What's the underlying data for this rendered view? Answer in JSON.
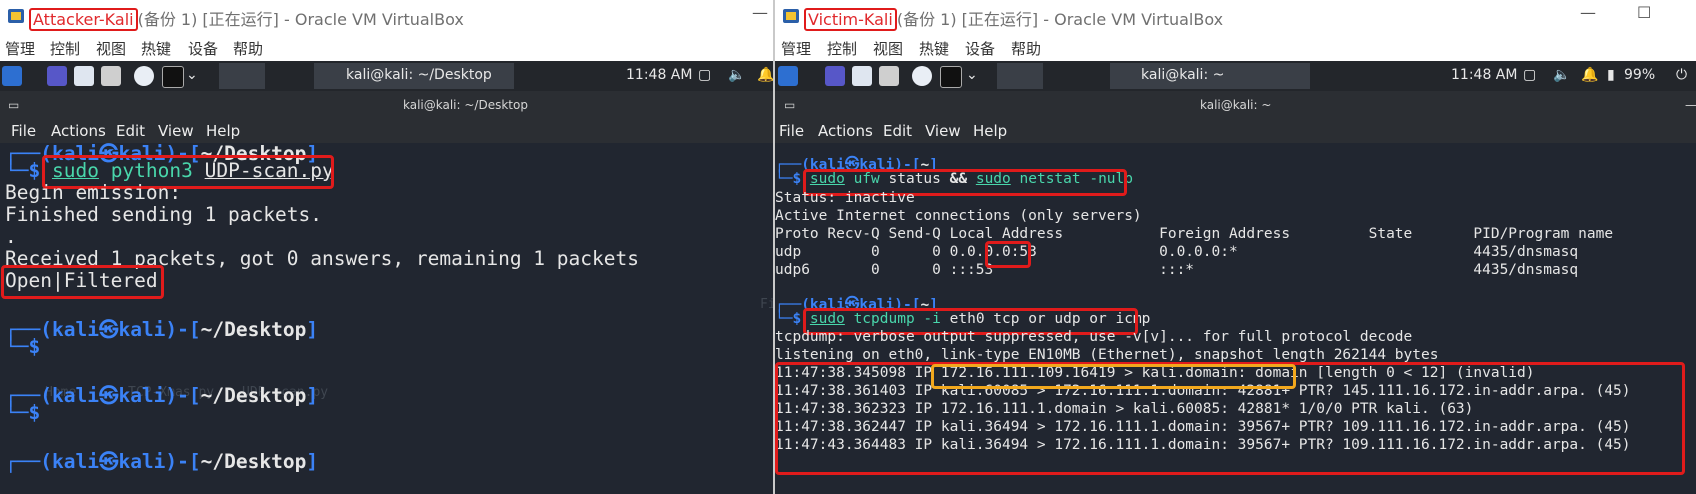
{
  "left": {
    "window_title_vm": "Attacker-Kali",
    "window_title_rest": "(备份 1) [正在运行] - Oracle VM VirtualBox",
    "menu": [
      "管理",
      "控制",
      "视图",
      "热键",
      "设备",
      "帮助"
    ],
    "panel": {
      "task_label": "kali@kali: ~/Desktop",
      "clock": "11:48 AM"
    },
    "term_title": "kali@kali: ~/Desktop",
    "term_menu": [
      "File",
      "Actions",
      "Edit",
      "View",
      "Help"
    ],
    "terminal": {
      "prompt_user": "kali",
      "prompt_at": "㉿",
      "prompt_host": "kali",
      "dir": "~/Desktop",
      "cmd_sudo": "sudo",
      "cmd_python": "python3",
      "cmd_script": "UDP-scan.py",
      "out1": "Begin emission:",
      "out2": "Finished sending 1 packets.",
      "out3": ".",
      "out4": "Received 1 packets, got 0 answers, remaining 1 packets",
      "out5": "Open|Filtered"
    },
    "watermark": {
      "items": [
        "Home",
        "TCP-Xmas.py",
        "UDP-scan.py"
      ],
      "fs": "File System"
    }
  },
  "right": {
    "window_title_vm": "Victim-Kali",
    "window_title_rest": "(备份 1) [正在运行] - Oracle VM VirtualBox",
    "menu": [
      "管理",
      "控制",
      "视图",
      "热键",
      "设备",
      "帮助"
    ],
    "panel": {
      "task_label": "kali@kali: ~",
      "clock": "11:48 AM",
      "battery": "99%"
    },
    "term_title": "kali@kali: ~",
    "term_menu": [
      "File",
      "Actions",
      "Edit",
      "View",
      "Help"
    ],
    "terminal": {
      "prompt_user": "kali",
      "prompt_at": "㉿",
      "prompt_host": "kali",
      "dir": "~",
      "cmd1": {
        "sudo1": "sudo",
        "ufw": "ufw",
        "status": "status",
        "and": "&&",
        "sudo2": "sudo",
        "netstat": "netstat",
        "flags": "-nulp"
      },
      "status": "Status: inactive",
      "active": "Active Internet connections (only servers)",
      "netstat_rows": [
        "Proto Recv-Q Send-Q Local Address           Foreign Address         State       PID/Program name",
        "udp        0      0 0.0.0.0:53              0.0.0.0:*                           4435/dnsmasq",
        "udp6       0      0 :::53                   :::*                                4435/dnsmasq"
      ],
      "cmd2": {
        "sudo": "sudo",
        "tcpdump": "tcpdump",
        "flag": "-i",
        "rest": "eth0 tcp or udp or icmp"
      },
      "tcpdump_info": [
        "tcpdump: verbose output suppressed, use -v[v]... for full protocol decode",
        "listening on eth0, link-type EN10MB (Ethernet), snapshot length 262144 bytes"
      ],
      "packets": [
        "11:47:38.345098 IP 172.16.111.109.16419 > kali.domain: domain [length 0 < 12] (invalid)",
        "11:47:38.361403 IP kali.60085 > 172.16.111.1.domain: 42881+ PTR? 145.111.16.172.in-addr.arpa. (45)",
        "11:47:38.362323 IP 172.16.111.1.domain > kali.60085: 42881* 1/0/0 PTR kali. (63)",
        "11:47:38.362447 IP kali.36494 > 172.16.111.1.domain: 39567+ PTR? 109.111.16.172.in-addr.arpa. (45)",
        "11:47:43.364483 IP kali.36494 > 172.16.111.1.domain: 39567+ PTR? 109.111.16.172.in-addr.arpa. (45)"
      ]
    }
  }
}
